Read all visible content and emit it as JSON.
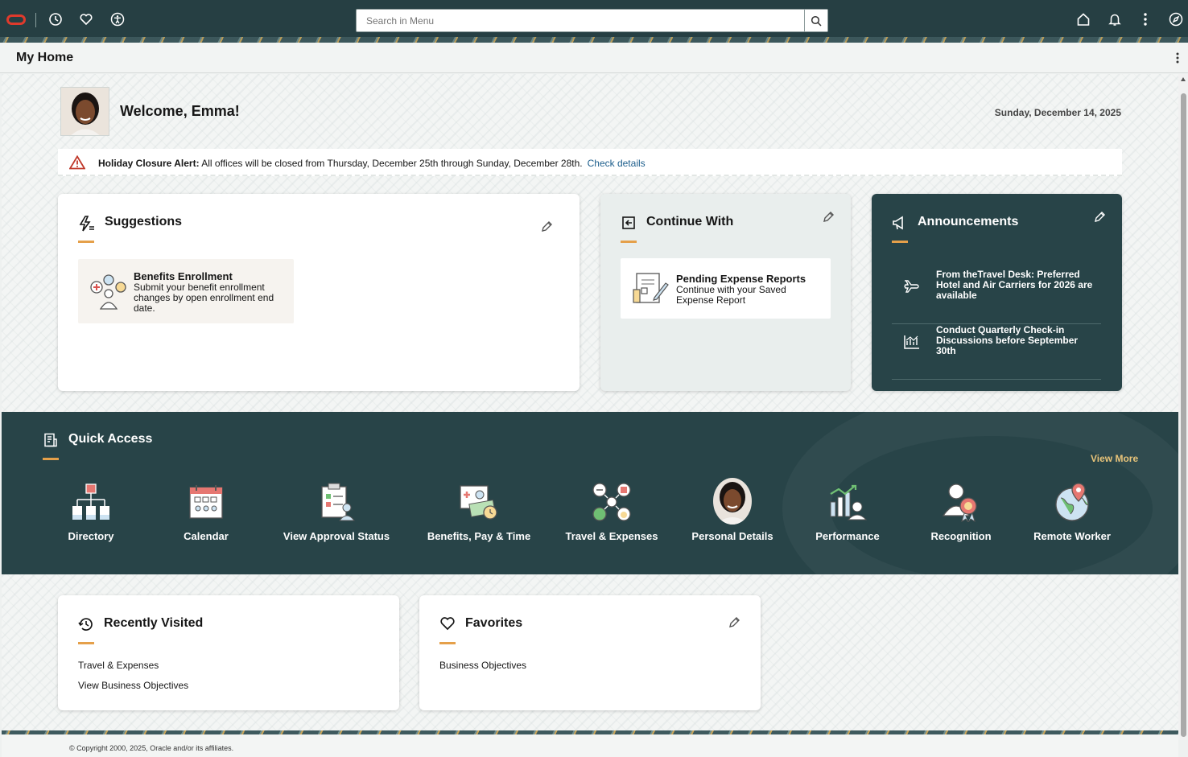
{
  "search": {
    "placeholder": "Search in Menu"
  },
  "page": {
    "title": "My Home"
  },
  "welcome": {
    "text": "Welcome, Emma!",
    "date": "Sunday, December 14, 2025"
  },
  "alert": {
    "label": "Holiday Closure Alert:",
    "message": " All offices will be closed from Thursday, December 25th through Sunday, December 28th.",
    "link": "Check details"
  },
  "suggestions": {
    "title": "Suggestions",
    "item": {
      "title": "Benefits Enrollment",
      "desc": "Submit your benefit enrollment changes by open enrollment end date."
    }
  },
  "continue_with": {
    "title": "Continue With",
    "item": {
      "title": "Pending Expense Reports",
      "desc": "Continue with your Saved Expense Report"
    }
  },
  "announcements": {
    "title": "Announcements",
    "items": [
      {
        "text": "From theTravel Desk: Preferred Hotel and Air Carriers for 2026 are available"
      },
      {
        "text": "Conduct Quarterly Check-in Discussions before September 30th"
      }
    ]
  },
  "quick_access": {
    "title": "Quick Access",
    "view_more": "View More",
    "items": [
      {
        "label": "Directory"
      },
      {
        "label": "Calendar"
      },
      {
        "label": "View Approval Status"
      },
      {
        "label": "Benefits, Pay & Time"
      },
      {
        "label": "Travel & Expenses"
      },
      {
        "label": "Personal Details"
      },
      {
        "label": "Performance"
      },
      {
        "label": "Recognition"
      },
      {
        "label": "Remote Worker"
      }
    ]
  },
  "recently_visited": {
    "title": "Recently Visited",
    "items": [
      {
        "label": "Travel & Expenses"
      },
      {
        "label": "View Business Objectives"
      }
    ]
  },
  "favorites": {
    "title": "Favorites",
    "items": [
      {
        "label": "Business Objectives"
      }
    ]
  },
  "footer": {
    "copyright": "© Copyright 2000, 2025, Oracle and/or its affiliates."
  },
  "colors": {
    "header": "#263f43",
    "accent": "#e5a04a",
    "panel_dark": "#284448",
    "link": "#1d5e8c"
  }
}
